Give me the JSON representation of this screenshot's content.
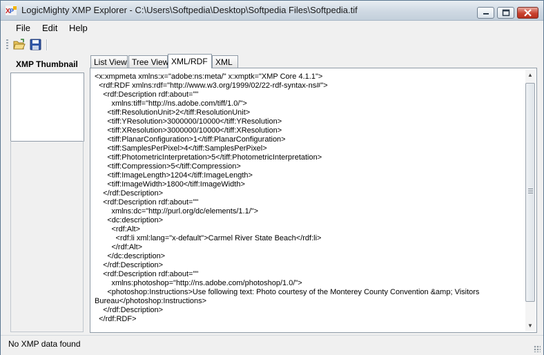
{
  "window": {
    "title": "LogicMighty XMP Explorer - C:\\Users\\Softpedia\\Desktop\\Softpedia Files\\Softpedia.tif",
    "app_icon": "xmp-app-icon",
    "controls": [
      "minimize-icon",
      "maximize-icon",
      "close-icon"
    ]
  },
  "menu": {
    "file": "File",
    "edit": "Edit",
    "help": "Help"
  },
  "toolbar": {
    "buttons": [
      "open-folder-icon",
      "save-disk-icon"
    ]
  },
  "left_panel": {
    "thumbnail_label": "XMP Thumbnail"
  },
  "tabs": [
    {
      "label": "List View",
      "active": false
    },
    {
      "label": "Tree View",
      "active": false
    },
    {
      "label": "XML/RDF",
      "active": true
    },
    {
      "label": "XML",
      "active": false
    }
  ],
  "xml_lines": [
    "<x:xmpmeta xmlns:x=\"adobe:ns:meta/\" x:xmptk=\"XMP Core 4.1.1\">",
    "  <rdf:RDF xmlns:rdf=\"http://www.w3.org/1999/02/22-rdf-syntax-ns#\">",
    "    <rdf:Description rdf:about=\"\"",
    "        xmlns:tiff=\"http://ns.adobe.com/tiff/1.0/\">",
    "      <tiff:ResolutionUnit>2</tiff:ResolutionUnit>",
    "      <tiff:YResolution>3000000/10000</tiff:YResolution>",
    "      <tiff:XResolution>3000000/10000</tiff:XResolution>",
    "      <tiff:PlanarConfiguration>1</tiff:PlanarConfiguration>",
    "      <tiff:SamplesPerPixel>4</tiff:SamplesPerPixel>",
    "      <tiff:PhotometricInterpretation>5</tiff:PhotometricInterpretation>",
    "      <tiff:Compression>5</tiff:Compression>",
    "      <tiff:ImageLength>1204</tiff:ImageLength>",
    "      <tiff:ImageWidth>1800</tiff:ImageWidth>",
    "    </rdf:Description>",
    "    <rdf:Description rdf:about=\"\"",
    "        xmlns:dc=\"http://purl.org/dc/elements/1.1/\">",
    "      <dc:description>",
    "        <rdf:Alt>",
    "          <rdf:li xml:lang=\"x-default\">Carmel River State Beach</rdf:li>",
    "        </rdf:Alt>",
    "      </dc:description>",
    "    </rdf:Description>",
    "    <rdf:Description rdf:about=\"\"",
    "        xmlns:photoshop=\"http://ns.adobe.com/photoshop/1.0/\">",
    "      <photoshop:Instructions>Use following text: Photo courtesy of the Monterey County Convention &amp; Visitors",
    "Bureau</photoshop:Instructions>",
    "    </rdf:Description>",
    "  </rdf:RDF>"
  ],
  "status": {
    "text": "No XMP data found"
  }
}
